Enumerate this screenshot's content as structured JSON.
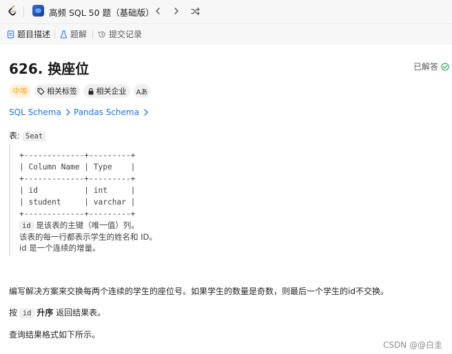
{
  "topbar": {
    "study_title": "高频 SQL 50 题（基础版）"
  },
  "tabs": [
    {
      "label": "题目描述"
    },
    {
      "label": "题解"
    },
    {
      "label": "提交记录"
    }
  ],
  "problem": {
    "title": "626. 换座位",
    "solved_label": "已解答",
    "difficulty": "中等",
    "tags": [
      {
        "label": "相关标签"
      },
      {
        "label": "相关企业"
      },
      {
        "label": "Aあ"
      }
    ],
    "links": [
      {
        "label": "SQL Schema"
      },
      {
        "label": "Pandas Schema"
      }
    ],
    "table_intro": "表:",
    "table_name": "Seat",
    "schema_lines": [
      "+-------------+---------+",
      "| Column Name | Type    |",
      "+-------------+---------+",
      "| id          | int     |",
      "| student     | varchar |",
      "+-------------+---------+"
    ],
    "schema_notes": {
      "line1_code": "id",
      "line1_text": " 是该表的主键（唯一值）列。",
      "line2": "该表的每一行都表示学生的姓名和 ID。",
      "line3": "id 是一个连续的增量。"
    },
    "description": "编写解决方案来交换每两个连续的学生的座位号。如果学生的数量是奇数，则最后一个学生的id不交换。",
    "order_prefix": "按",
    "order_code": "id",
    "order_bold": "升序",
    "order_suffix": "返回结果表。",
    "format_text": "查询结果格式如下所示。"
  },
  "watermark": "CSDN @@白圭"
}
